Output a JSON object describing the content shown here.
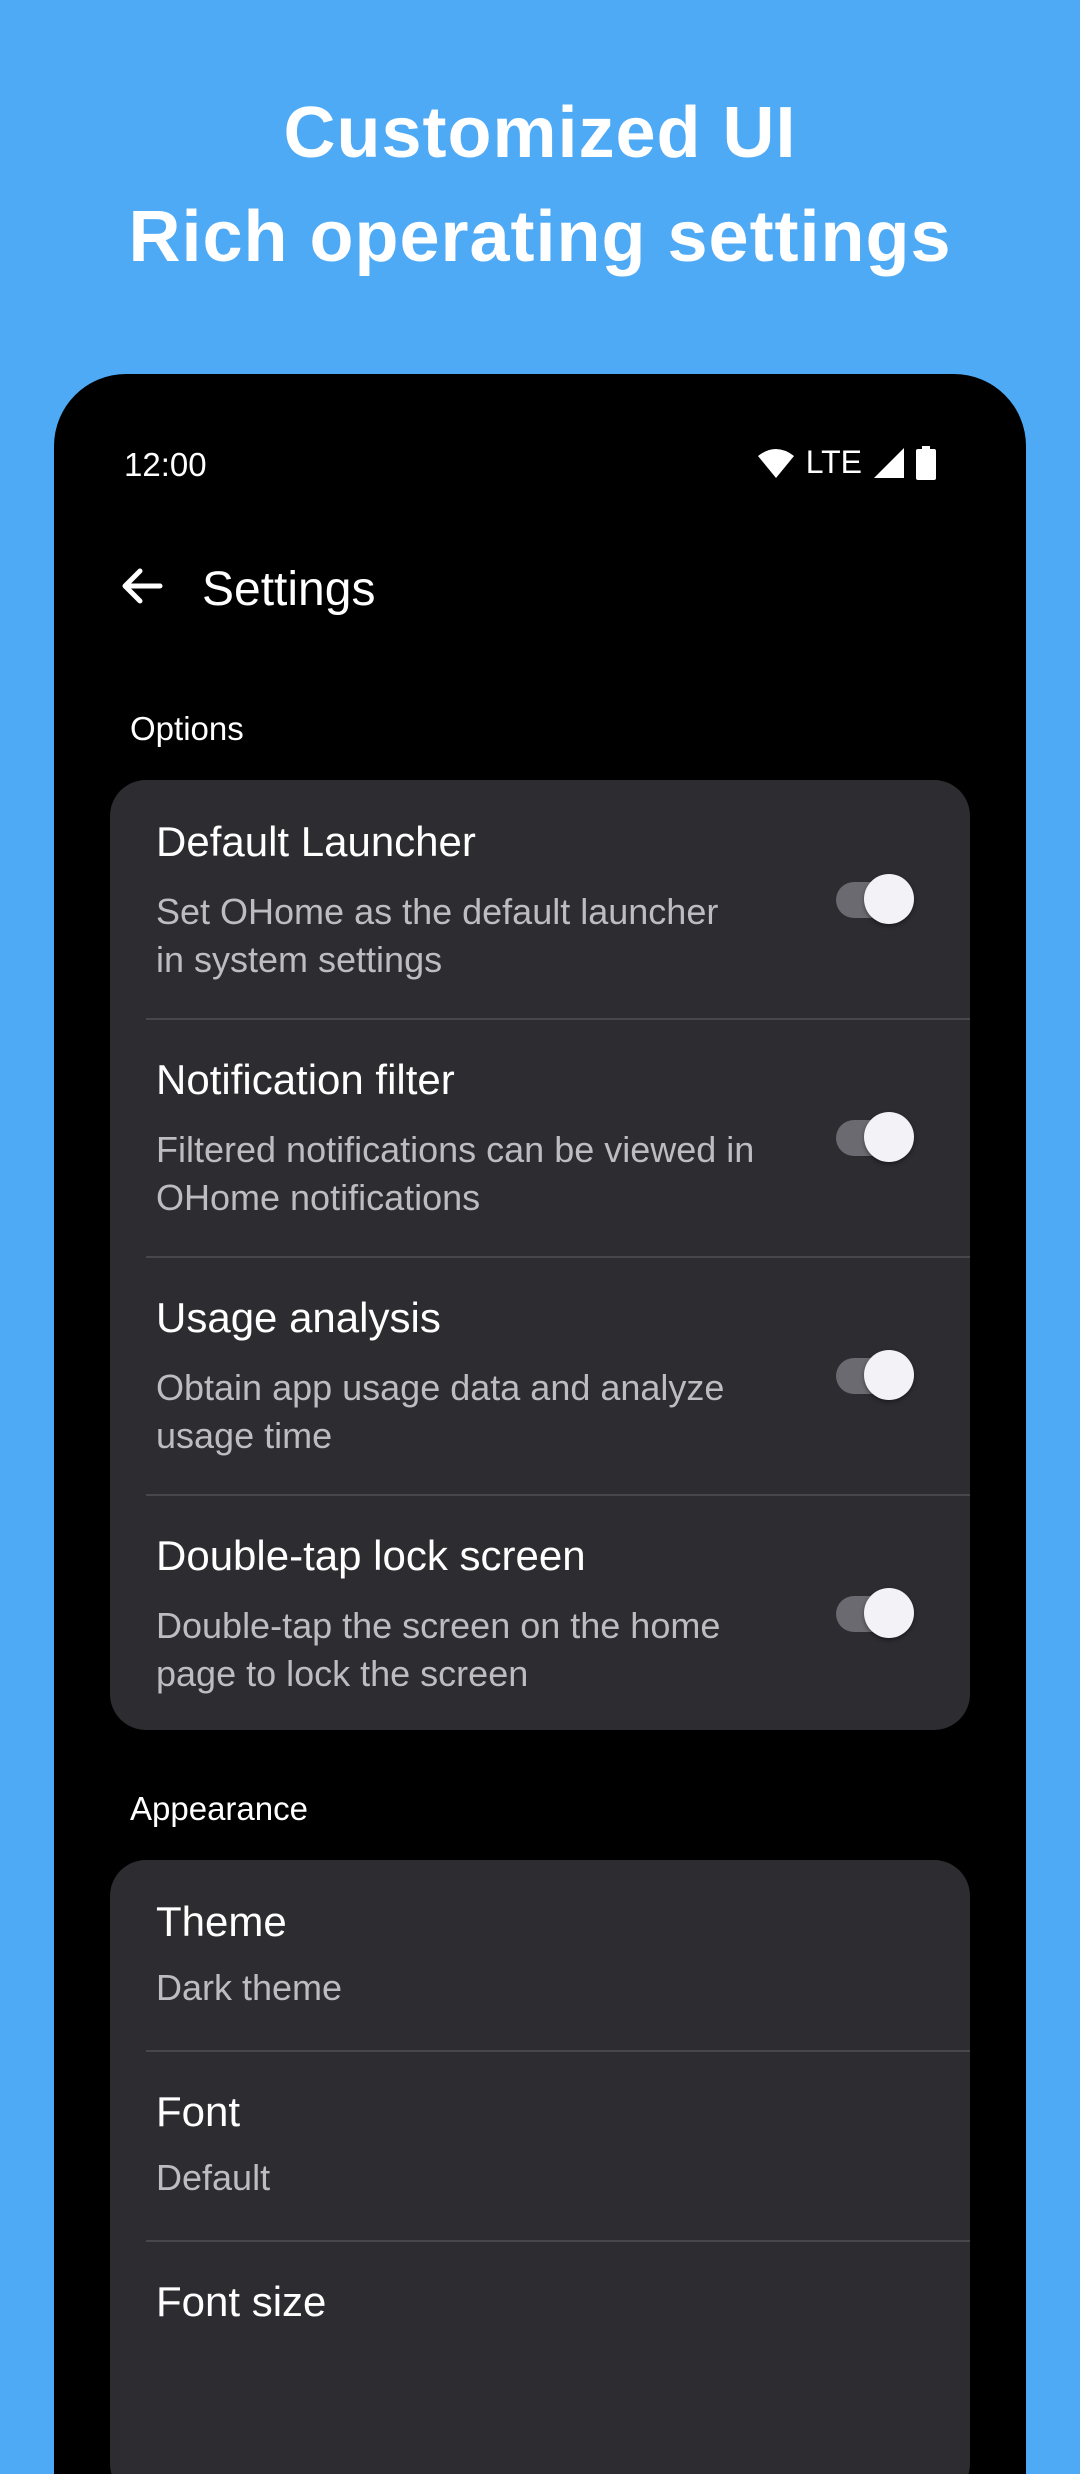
{
  "promo": {
    "line1": "Customized UI",
    "line2": "Rich operating settings"
  },
  "status_bar": {
    "time": "12:00",
    "network": "LTE",
    "icons": [
      "wifi-icon",
      "signal-icon",
      "battery-icon"
    ]
  },
  "app_bar": {
    "back_icon": "back-arrow-icon",
    "title": "Settings"
  },
  "sections": {
    "options": {
      "label": "Options",
      "items": [
        {
          "title": "Default Launcher",
          "subtitle": "Set OHome as the default launcher in system settings",
          "enabled": true
        },
        {
          "title": "Notification filter",
          "subtitle": "Filtered notifications can be viewed in OHome notifications",
          "enabled": true
        },
        {
          "title": "Usage analysis",
          "subtitle": "Obtain app usage data and analyze usage time",
          "enabled": true
        },
        {
          "title": "Double-tap lock screen",
          "subtitle": "Double-tap the screen on the home page to lock the screen",
          "enabled": true
        }
      ]
    },
    "appearance": {
      "label": "Appearance",
      "items": [
        {
          "title": "Theme",
          "value": "Dark theme"
        },
        {
          "title": "Font",
          "value": "Default"
        },
        {
          "title": "Font size",
          "value": ""
        }
      ]
    }
  },
  "colors": {
    "background": "#4FAAF6",
    "phone": "#000000",
    "card": "#2d2c30",
    "primary_text": "#ffffff",
    "secondary_text": "#bdbcc1"
  }
}
